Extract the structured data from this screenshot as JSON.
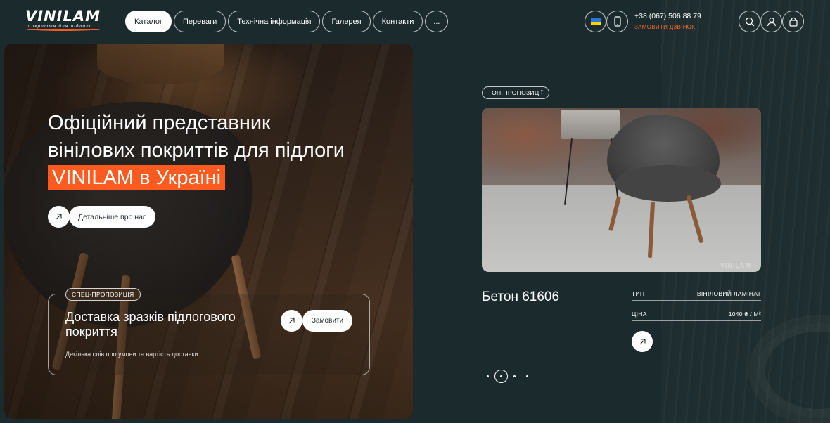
{
  "brand": {
    "logo_text": "VINILAM",
    "logo_tagline": "покриття для підлоги",
    "accent_color": "#ff5a1f",
    "background_color": "#1b2a2c"
  },
  "nav": {
    "items": [
      {
        "label": "Каталог",
        "active": true
      },
      {
        "label": "Переваги",
        "active": false
      },
      {
        "label": "Технічна інформація",
        "active": false
      },
      {
        "label": "Галерея",
        "active": false
      },
      {
        "label": "Контакти",
        "active": false
      }
    ],
    "more_label": "..."
  },
  "header": {
    "language_icon": "ukraine-flag-icon",
    "mobile_icon": "mobile-phone-icon",
    "phone": "+38 (067) 506 88 79",
    "callback_label": "ЗАМОВИТИ ДЗВІНОК",
    "search_icon": "search-icon",
    "user_icon": "user-icon",
    "cart_icon": "shopping-bag-icon"
  },
  "hero": {
    "title_line1": "Офіційний представник",
    "title_line2": "вінілових покриттів для підлоги",
    "title_highlight": "VINILAM в Україні",
    "about_button": "Детальніше про нас",
    "arrow_icon": "arrow-up-right-icon"
  },
  "offer": {
    "badge": "СПЕЦ-ПРОПОЗИЦІЯ",
    "title": "Доставка зразків підлогового покриття",
    "description": "Декілька слів про умови та вартість доставки",
    "order_button": "Замовити"
  },
  "product": {
    "badge": "ТОП-ПРОПОЗИЦІЇ",
    "watermark": "VINILAM",
    "name": "Бетон 61606",
    "specs": [
      {
        "label": "ТИП",
        "value": "ВІНІЛОВИЙ ЛАМІНАТ"
      },
      {
        "label": "ЦІНА",
        "value": "1040 ₴ / М²"
      }
    ],
    "slider": {
      "count": 4,
      "active_index": 1
    }
  }
}
